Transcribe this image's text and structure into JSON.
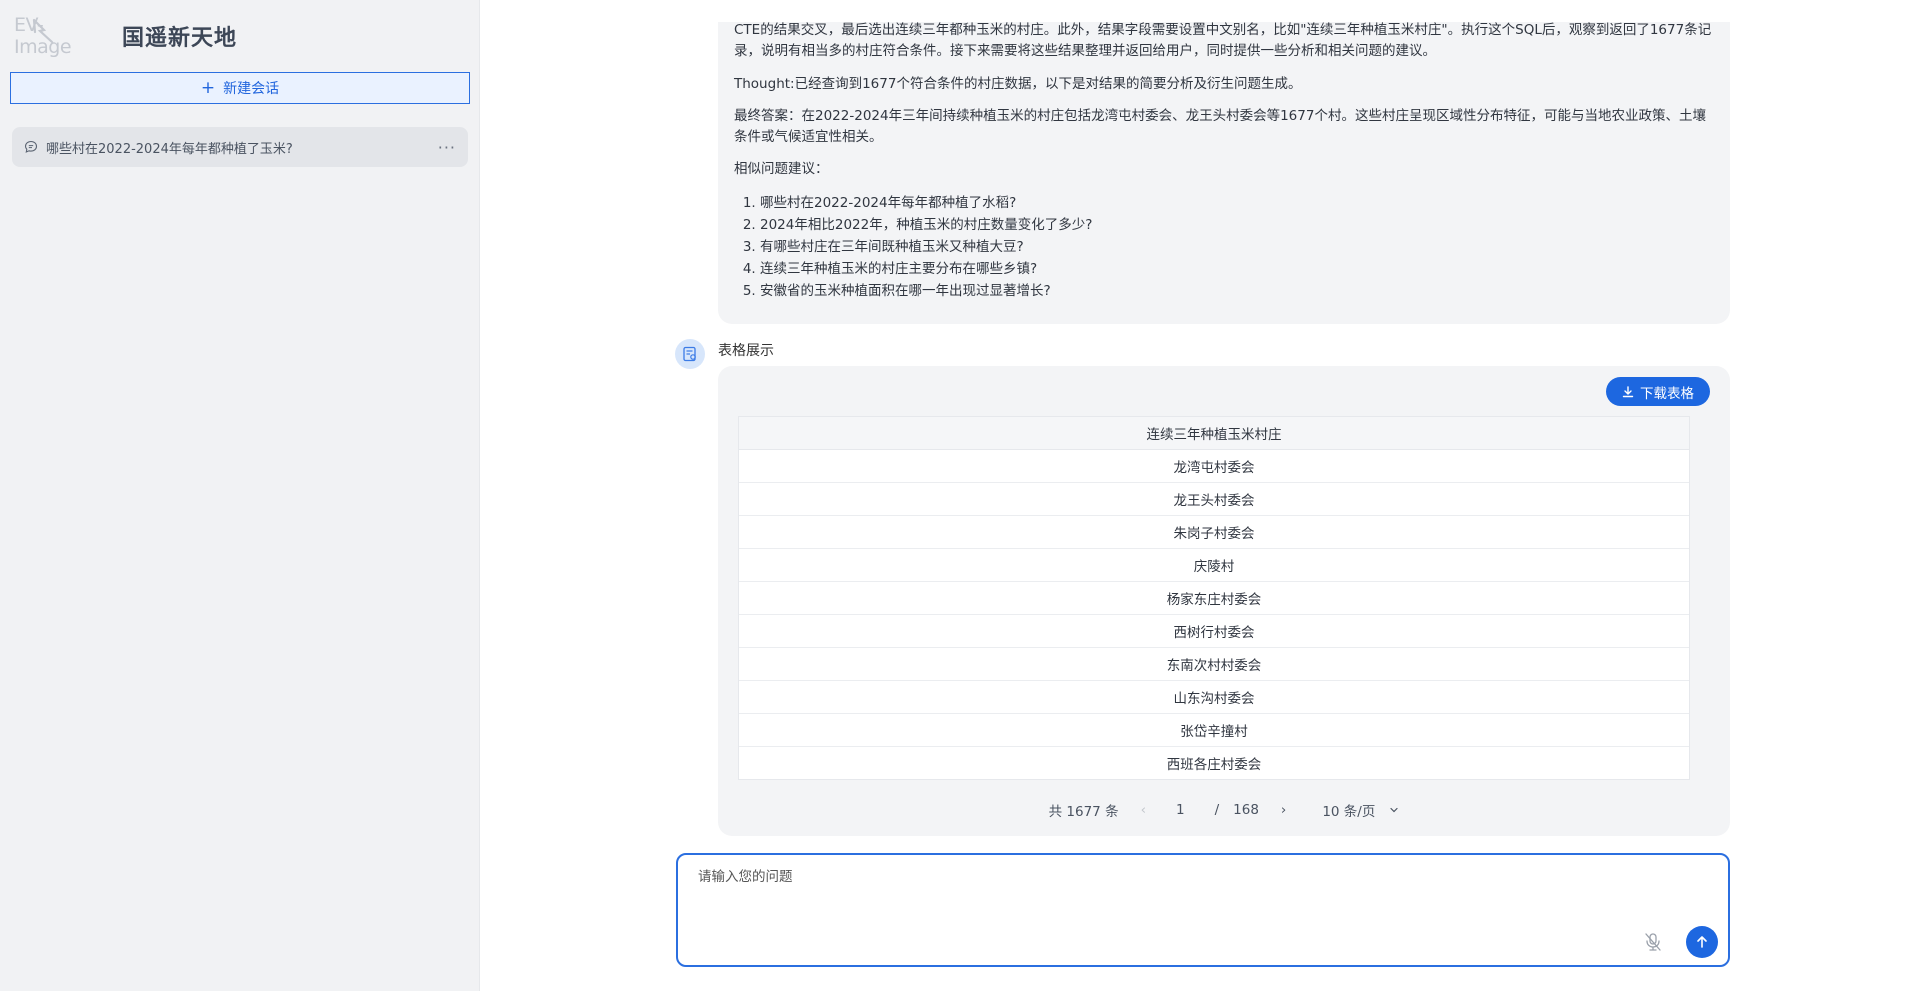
{
  "app": {
    "logo_text": "EV-Image",
    "title": "国遥新天地"
  },
  "sidebar": {
    "new_chat_label": "新建会话",
    "sessions": [
      {
        "label": "哪些村在2022-2024年每年都种植了玉米?"
      }
    ]
  },
  "answer": {
    "para1": "CTE的结果交叉，最后选出连续三年都种玉米的村庄。此外，结果字段需要设置中文别名，比如\"连续三年种植玉米村庄\"。执行这个SQL后，观察到返回了1677条记录，说明有相当多的村庄符合条件。接下来需要将这些结果整理并返回给用户，同时提供一些分析和相关问题的建议。",
    "para2": "Thought:已经查询到1677个符合条件的村庄数据，以下是对结果的简要分析及衍生问题生成。",
    "para3": "最终答案：在2022-2024年三年间持续种植玉米的村庄包括龙湾屯村委会、龙王头村委会等1677个村。这些村庄呈现区域性分布特征，可能与当地农业政策、土壤条件或气候适宜性相关。",
    "suggest_title": "相似问题建议：",
    "suggestions": [
      "哪些村在2022-2024年每年都种植了水稻?",
      "2024年相比2022年，种植玉米的村庄数量变化了多少?",
      "有哪些村庄在三年间既种植玉米又种植大豆?",
      "连续三年种植玉米的村庄主要分布在哪些乡镇?",
      "安徽省的玉米种植面积在哪一年出现过显著增长?"
    ]
  },
  "table_section": {
    "label": "表格展示",
    "download_label": "下载表格",
    "column": "连续三年种植玉米村庄",
    "rows": [
      "龙湾屯村委会",
      "龙王头村委会",
      "朱岗子村委会",
      "庆陵村",
      "杨家东庄村委会",
      "西树行村委会",
      "东南次村村委会",
      "山东沟村委会",
      "张岱辛撞村",
      "西班各庄村委会"
    ],
    "pagination": {
      "total": "共 1677 条",
      "current": "1",
      "separator": "/",
      "pages": "168",
      "page_size": "10 条/页"
    }
  },
  "input": {
    "placeholder": "请输入您的问题"
  },
  "colors": {
    "accent": "#1d67e0",
    "sidebar_bg": "#f1f2f4",
    "card_bg": "#f3f4f6"
  }
}
